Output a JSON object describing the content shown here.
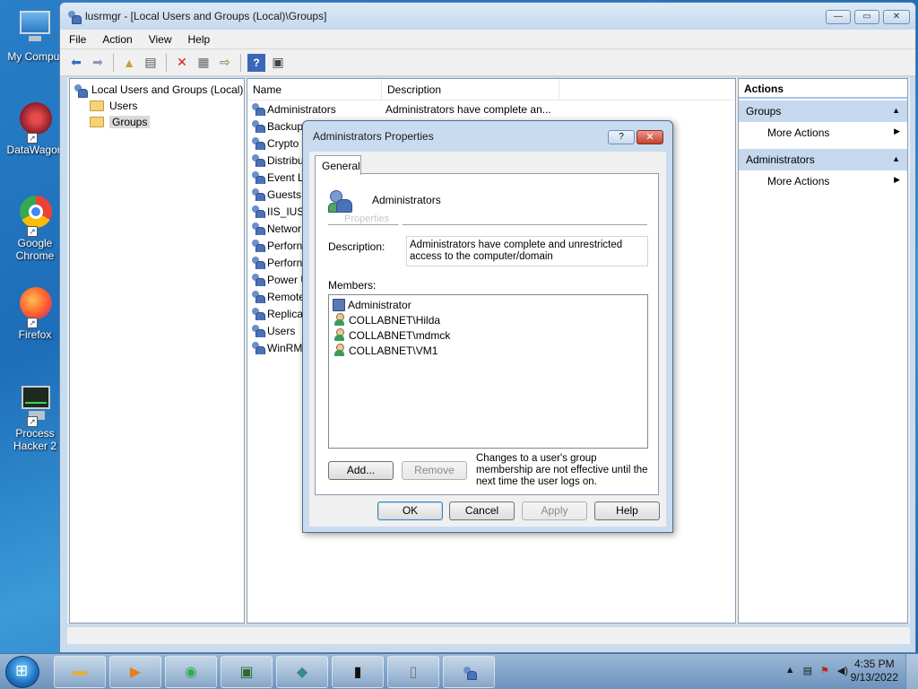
{
  "desktop": {
    "icons": [
      {
        "label": "My Comput",
        "icon": "computer-icon"
      },
      {
        "label": "DataWagon",
        "icon": "datawagon-icon"
      },
      {
        "label": "Google Chrome",
        "icon": "chrome-icon"
      },
      {
        "label": "Firefox",
        "icon": "firefox-icon"
      },
      {
        "label": "Process Hacker 2",
        "icon": "process-hacker-icon"
      }
    ]
  },
  "window": {
    "title": "lusrmgr - [Local Users and Groups (Local)\\Groups]",
    "menu": [
      "File",
      "Action",
      "View",
      "Help"
    ]
  },
  "tree": {
    "root": "Local Users and Groups (Local)",
    "children": [
      "Users",
      "Groups"
    ],
    "selected": "Groups"
  },
  "list": {
    "columns": [
      "Name",
      "Description"
    ],
    "rows": [
      {
        "name": "Administrators",
        "description": "Administrators have complete an..."
      },
      {
        "name": "Backup",
        "description": ""
      },
      {
        "name": "Crypto",
        "description": ""
      },
      {
        "name": "Distribu",
        "description": ""
      },
      {
        "name": "Event L",
        "description": ""
      },
      {
        "name": "Guests",
        "description": ""
      },
      {
        "name": "IIS_IUSR",
        "description": ""
      },
      {
        "name": "Networ",
        "description": ""
      },
      {
        "name": "Perforn",
        "description": ""
      },
      {
        "name": "Perforn",
        "description": ""
      },
      {
        "name": "Power U",
        "description": ""
      },
      {
        "name": "Remote",
        "description": ""
      },
      {
        "name": "Replica",
        "description": ""
      },
      {
        "name": "Users",
        "description": ""
      },
      {
        "name": "WinRM",
        "description": ""
      }
    ]
  },
  "actions": {
    "title": "Actions",
    "sections": [
      {
        "label": "Groups",
        "item": "More Actions"
      },
      {
        "label": "Administrators",
        "item": "More Actions"
      }
    ]
  },
  "dialog": {
    "title": "Administrators Properties",
    "tab": "General",
    "group_name": "Administrators",
    "ghost_text": "Properties",
    "description_label": "Description:",
    "description": "Administrators have complete and unrestricted access to the computer/domain",
    "members_label": "Members:",
    "members": [
      {
        "name": "Administrator",
        "icon": "user-computer-icon"
      },
      {
        "name": "COLLABNET\\Hilda",
        "icon": "user-icon"
      },
      {
        "name": "COLLABNET\\mdmck",
        "icon": "user-icon"
      },
      {
        "name": "COLLABNET\\VM1",
        "icon": "user-icon"
      }
    ],
    "add_label": "Add...",
    "remove_label": "Remove",
    "note": "Changes to a user's group membership are not effective until the next time the user logs on.",
    "ok_label": "OK",
    "cancel_label": "Cancel",
    "apply_label": "Apply",
    "help_label": "Help"
  },
  "taskbar": {
    "time": "4:35 PM",
    "date": "9/13/2022"
  }
}
